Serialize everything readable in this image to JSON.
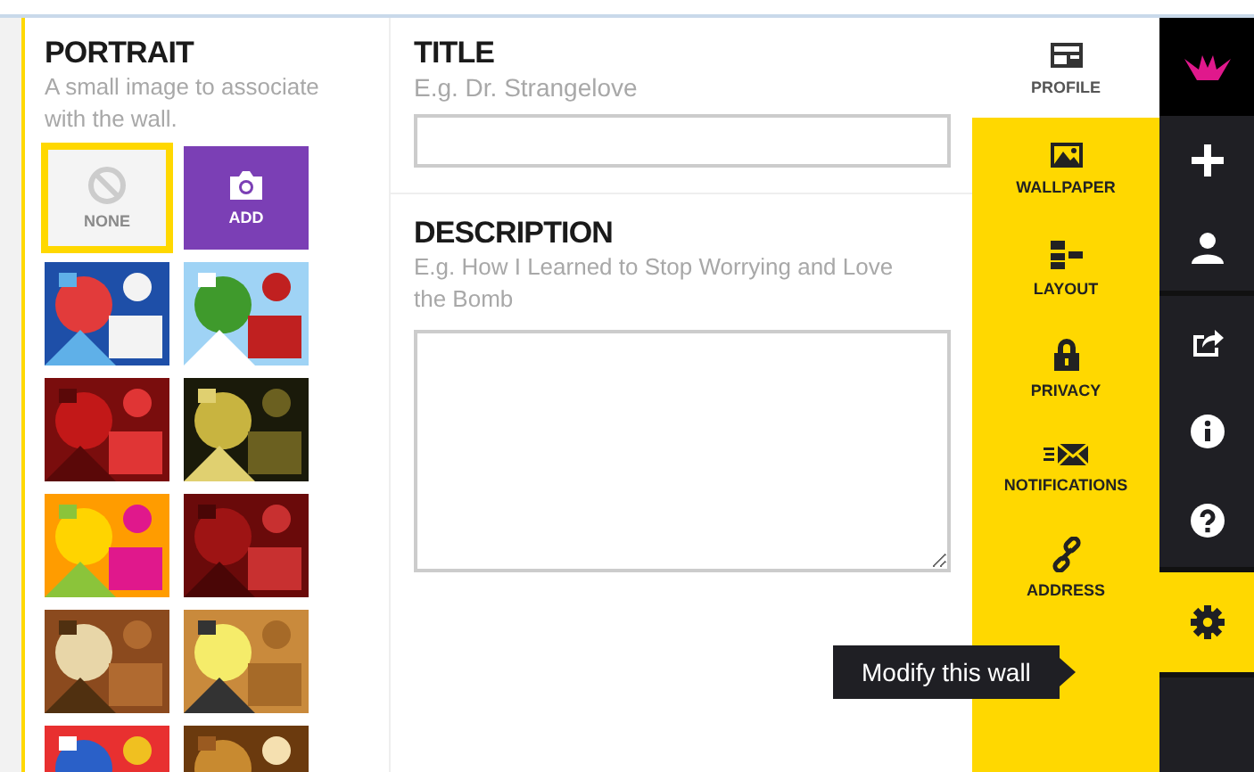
{
  "portrait": {
    "title": "PORTRAIT",
    "hint": "A small image to associate with the wall.",
    "options": [
      {
        "kind": "none",
        "label": "NONE",
        "selected": true
      },
      {
        "kind": "add",
        "label": "ADD",
        "selected": false
      },
      {
        "kind": "picture",
        "selected": false
      },
      {
        "kind": "picture",
        "selected": false
      },
      {
        "kind": "picture",
        "selected": false
      },
      {
        "kind": "picture",
        "selected": false
      },
      {
        "kind": "picture",
        "selected": false
      },
      {
        "kind": "picture",
        "selected": false
      },
      {
        "kind": "picture",
        "selected": false
      },
      {
        "kind": "picture",
        "selected": false
      },
      {
        "kind": "picture",
        "selected": false
      },
      {
        "kind": "picture",
        "selected": false
      }
    ]
  },
  "title_field": {
    "label": "TITLE",
    "placeholder": "E.g. Dr. Strangelove"
  },
  "description_field": {
    "label": "DESCRIPTION",
    "placeholder": "E.g. How I Learned to Stop Worrying and Love the Bomb"
  },
  "settings_menu": [
    {
      "kind": "profile",
      "label": "PROFILE",
      "selected": true
    },
    {
      "kind": "wallpaper",
      "label": "WALLPAPER",
      "selected": false
    },
    {
      "kind": "layout",
      "label": "LAYOUT",
      "selected": false
    },
    {
      "kind": "privacy",
      "label": "PRIVACY",
      "selected": false
    },
    {
      "kind": "notifications",
      "label": "NOTIFICATIONS",
      "selected": false
    },
    {
      "kind": "address",
      "label": "ADDRESS",
      "selected": false
    }
  ],
  "sidebar": [
    {
      "kind": "plus",
      "selected": false
    },
    {
      "kind": "user",
      "selected": false
    },
    {
      "kind": "share",
      "selected": false
    },
    {
      "kind": "info",
      "selected": false
    },
    {
      "kind": "help",
      "selected": false
    },
    {
      "kind": "gear",
      "selected": true
    }
  ],
  "tooltip": {
    "text": "Modify this wall"
  }
}
